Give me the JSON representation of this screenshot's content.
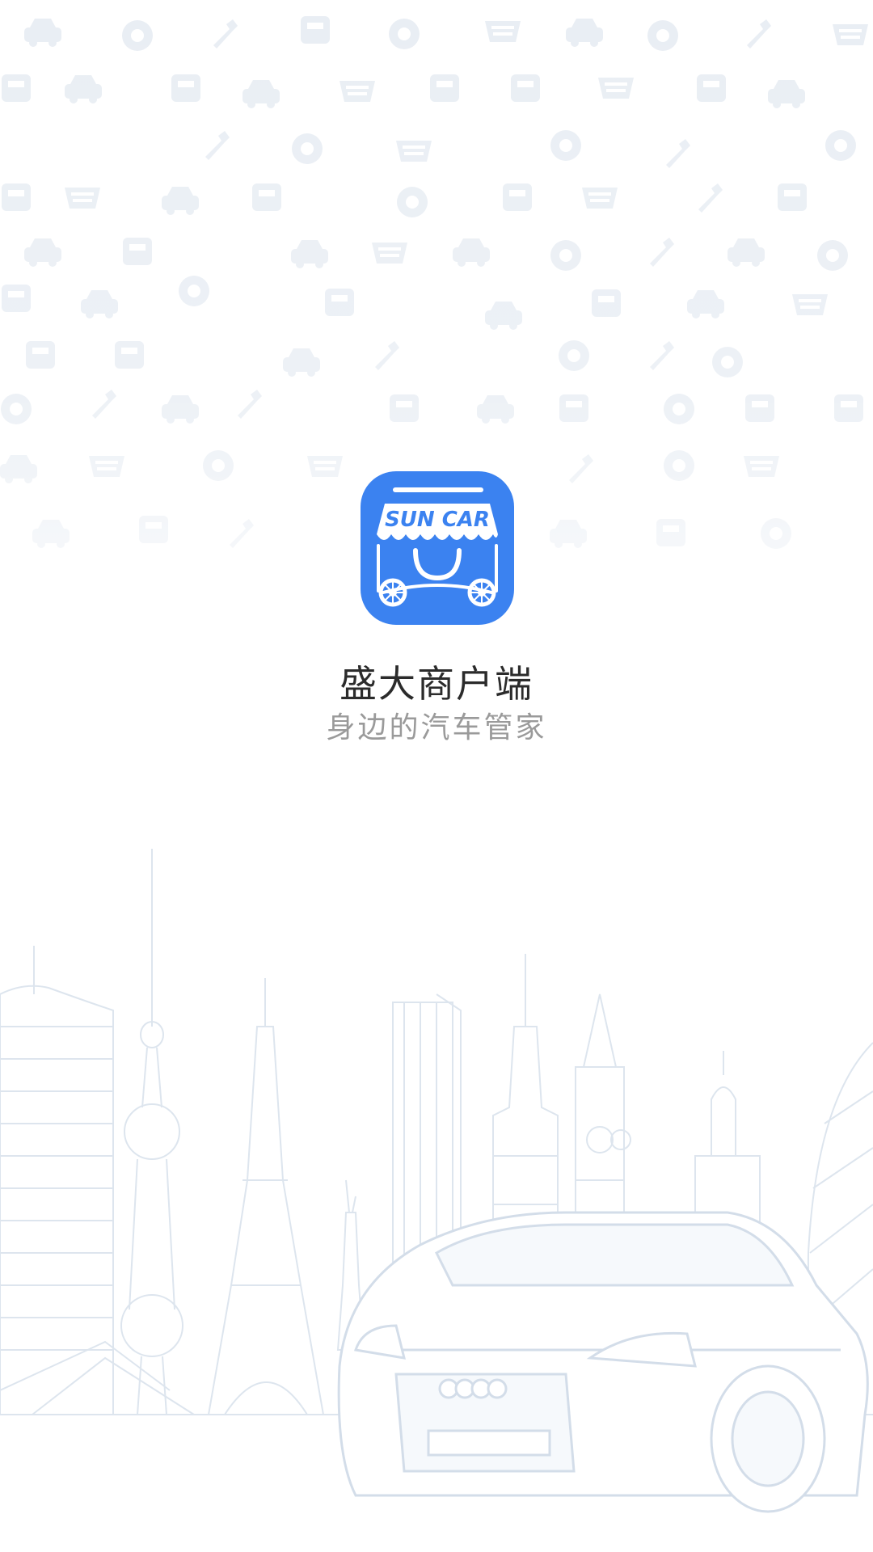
{
  "app": {
    "name": "盛大商户端",
    "slogan": "身边的汽车管家",
    "logo_text": "SUN CAR"
  },
  "icons": {
    "app_logo": "shop-cart-logo-icon",
    "background": "auto-service-pattern",
    "skyline": "city-skyline-with-car"
  },
  "colors": {
    "brand_blue": "#3b82f0",
    "title_text": "#2b2b2b",
    "subtitle_text": "#9a9a9a",
    "background": "#ffffff",
    "line_art": "#d9e3ee"
  }
}
